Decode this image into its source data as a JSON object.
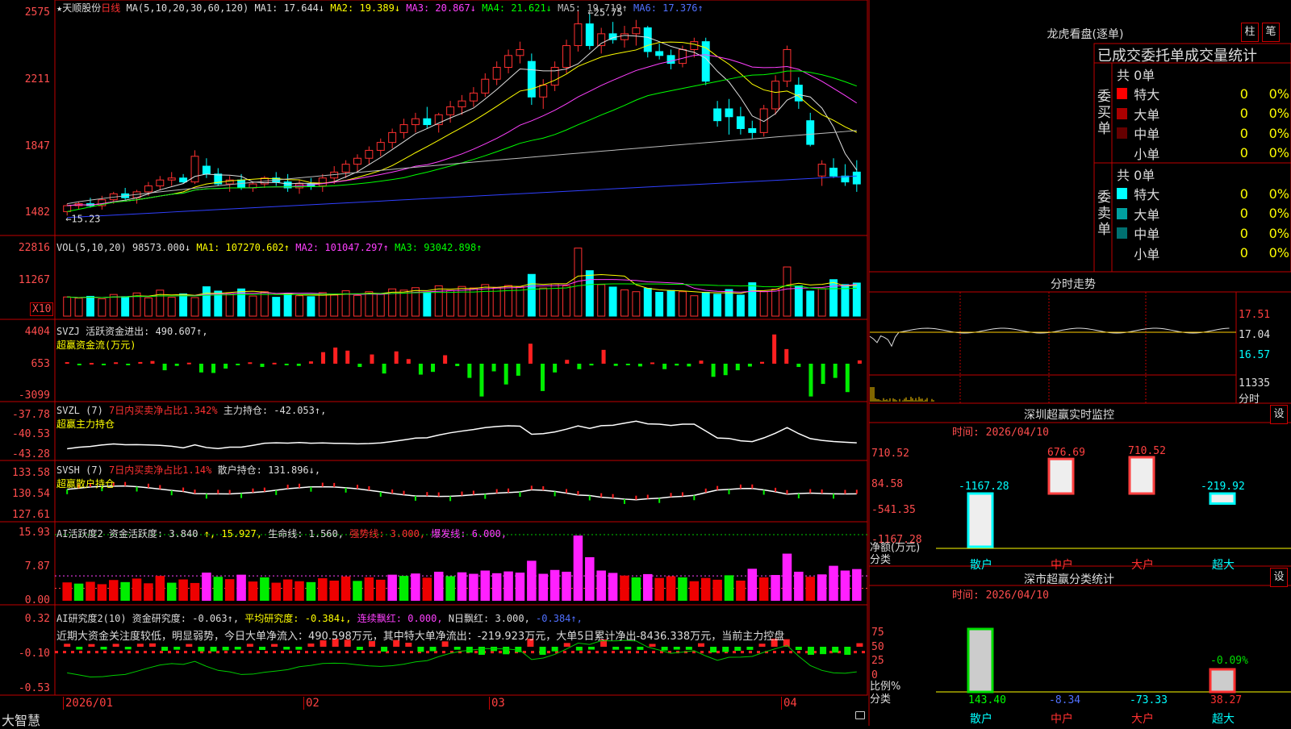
{
  "stock": {
    "name": "★天顺股份",
    "period": "日线",
    "ma_header": {
      "label": "MA(5,10,20,30,60,120)",
      "items": [
        {
          "text": "MA1: 17.644↓",
          "color": "#dddddd"
        },
        {
          "text": "MA2: 19.389↓",
          "color": "#ffff00"
        },
        {
          "text": "MA3: 20.867↓",
          "color": "#ff40ff"
        },
        {
          "text": "MA4: 21.621↓",
          "color": "#00ff00"
        },
        {
          "text": "MA5: 19.719↑",
          "color": "#bbbbbb"
        },
        {
          "text": "MA6: 17.376↑",
          "color": "#5070ff"
        }
      ]
    },
    "high_marker": "25.75",
    "low_marker": "15.23"
  },
  "main_axis": [
    "2575",
    "2211",
    "1847",
    "1482"
  ],
  "vol": {
    "header": {
      "label": "VOL(5,10,20)",
      "value": "98573.000↓",
      "items": [
        {
          "text": "MA1: 107270.602↑",
          "color": "#ffff00"
        },
        {
          "text": "MA2: 101047.297↑",
          "color": "#ff40ff"
        },
        {
          "text": "MA3: 93042.898↑",
          "color": "#00ff00"
        }
      ]
    },
    "axis": [
      "22816",
      "11267"
    ],
    "unit": "X10"
  },
  "svzj": {
    "line1": "SVZJ  活跃资金进出: 490.607↑,",
    "line2": "超赢资金流(万元)",
    "axis": [
      "4404",
      "653",
      "-3099"
    ]
  },
  "svzl": {
    "line1a": "SVZL (7)",
    "line1b": "7日内买卖净占比1.342%",
    "line1c": "主力持仓: -42.053↑,",
    "line2": "超赢主力持仓",
    "axis": [
      "-37.78",
      "-40.53",
      "-43.28"
    ]
  },
  "svsh": {
    "line1a": "SVSH (7)",
    "line1b": "7日内买卖净占比1.14%",
    "line1c": "散户持仓: 131.896↓,",
    "line2": "超赢散户持仓",
    "axis": [
      "133.58",
      "130.54",
      "127.61"
    ]
  },
  "ai1": {
    "items": [
      {
        "text": "AI活跃度2 资金活跃度: 3.840",
        "color": "#dddddd"
      },
      {
        "text": "↑, 15.927,",
        "color": "#ffff00"
      },
      {
        "text": " 生命线: 1.560,",
        "color": "#dddddd"
      },
      {
        "text": " 强势线: 3.000,",
        "color": "#ff3030"
      },
      {
        "text": " 爆发线: 6.000,",
        "color": "#ff40ff"
      }
    ],
    "axis": [
      "15.93",
      "7.87",
      "0.00"
    ]
  },
  "ai2": {
    "items": [
      {
        "text": "AI研究度2(10) 资金研究度: -0.063↑,",
        "color": "#dddddd"
      },
      {
        "text": " 平均研究度: -0.384↓,",
        "color": "#ffff00"
      },
      {
        "text": " 连续飘红: 0.000,",
        "color": "#ff40ff"
      },
      {
        "text": " N日飘红: 3.000,",
        "color": "#dddddd"
      },
      {
        "text": " -0.384↑,",
        "color": "#5070ff"
      }
    ],
    "comment": "近期大资金关注度较低，明显弱势，今日大单净流入：490.598万元，其中特大单净流出：-219.923万元，大单5日累计净出-8436.338万元，当前主力控盘",
    "axis": [
      "0.32",
      "-0.10",
      "-0.53"
    ]
  },
  "bottom": {
    "logo": "大智慧",
    "dates": [
      {
        "text": "2026/01",
        "x": 78
      },
      {
        "text": "02",
        "x": 376
      },
      {
        "text": "03",
        "x": 606
      },
      {
        "text": "04",
        "x": 968
      }
    ]
  },
  "longhu": {
    "title": "龙虎看盘(逐单)",
    "tab_a": "柱",
    "tab_b": "笔",
    "header": "已成交委托单成交量统计",
    "buy_label": "委买单",
    "sell_label": "委卖单",
    "buy_total": "共 0单",
    "sell_total": "共 0单",
    "buy_rows": [
      {
        "label": "特大",
        "color": "#ff0000",
        "count": "0",
        "pct": "0%"
      },
      {
        "label": "大单",
        "color": "#aa0000",
        "count": "0",
        "pct": "0%"
      },
      {
        "label": "中单",
        "color": "#660000",
        "count": "0",
        "pct": "0%"
      },
      {
        "label": "小单",
        "color": "#000000",
        "count": "0",
        "pct": "0%"
      }
    ],
    "sell_rows": [
      {
        "label": "特大",
        "color": "#00ffff",
        "count": "0",
        "pct": "0%"
      },
      {
        "label": "大单",
        "color": "#00a0a0",
        "count": "0",
        "pct": "0%"
      },
      {
        "label": "中单",
        "color": "#007070",
        "count": "0",
        "pct": "0%"
      },
      {
        "label": "小单",
        "color": "#000000",
        "count": "0",
        "pct": "0%"
      }
    ]
  },
  "fenshi": {
    "title": "分时走势",
    "axis": [
      "17.51",
      "17.04",
      "16.57",
      "11335"
    ],
    "unit": "分时"
  },
  "monitor": {
    "title": "深圳超赢实时监控",
    "set": "设",
    "time": "时间: 2026/04/10",
    "axis": [
      "710.52",
      "84.58",
      "-541.35",
      "-1167.28"
    ],
    "ylabel": "净额(万元)",
    "xlabel": "分类",
    "categories": [
      "散户",
      "中户",
      "大户",
      "超大"
    ],
    "values": [
      "-1167.28",
      "676.69",
      "710.52",
      "-219.92"
    ]
  },
  "classify": {
    "title": "深市超赢分类统计",
    "set": "设",
    "time": "时间: 2026/04/10",
    "axis": [
      "75",
      "50",
      "25",
      "0"
    ],
    "ylabel": "比例%",
    "xlabel": "分类",
    "categories": [
      "散户",
      "中户",
      "大户",
      "超大"
    ],
    "values": [
      "143.40",
      "-8.34",
      "-73.33",
      "38.27"
    ],
    "extra_label": "-0.09%"
  },
  "chart_data": [
    {
      "type": "candlestick",
      "title": "天顺股份 日线",
      "ylim": [
        14.8,
        25.9
      ],
      "ticks": [
        "25.75",
        "22.11",
        "18.47",
        "14.82"
      ],
      "annotations": {
        "high": 25.75,
        "low": 15.23
      },
      "ma": {
        "MA1": 17.644,
        "MA2": 19.389,
        "MA3": 20.867,
        "MA4": 21.621,
        "MA5": 19.719,
        "MA6": 17.376
      },
      "ohlc": [
        [
          15.6,
          16.0,
          15.4,
          15.9
        ],
        [
          15.9,
          16.1,
          15.7,
          16.0
        ],
        [
          16.0,
          16.3,
          15.8,
          15.9
        ],
        [
          15.9,
          16.4,
          15.7,
          16.2
        ],
        [
          16.2,
          16.6,
          16.0,
          16.5
        ],
        [
          16.5,
          16.8,
          16.2,
          16.3
        ],
        [
          16.3,
          16.7,
          16.0,
          16.6
        ],
        [
          16.6,
          17.1,
          16.4,
          16.9
        ],
        [
          16.9,
          17.4,
          16.7,
          17.2
        ],
        [
          17.2,
          17.6,
          16.9,
          17.3
        ],
        [
          17.3,
          17.5,
          17.0,
          17.1
        ],
        [
          17.1,
          18.7,
          17.0,
          18.4
        ],
        [
          17.9,
          18.3,
          17.3,
          17.5
        ],
        [
          17.5,
          17.8,
          16.9,
          17.0
        ],
        [
          17.0,
          17.4,
          16.6,
          17.2
        ],
        [
          17.2,
          17.5,
          16.7,
          16.8
        ],
        [
          16.8,
          17.1,
          16.6,
          17.0
        ],
        [
          17.0,
          17.4,
          16.8,
          17.3
        ],
        [
          17.3,
          17.6,
          16.9,
          17.1
        ],
        [
          17.1,
          17.5,
          16.6,
          16.8
        ],
        [
          16.8,
          17.2,
          16.5,
          17.0
        ],
        [
          17.0,
          17.3,
          16.7,
          16.9
        ],
        [
          16.9,
          17.5,
          16.6,
          17.3
        ],
        [
          17.3,
          17.9,
          17.0,
          17.6
        ],
        [
          17.6,
          18.2,
          17.3,
          18.0
        ],
        [
          18.0,
          18.5,
          17.6,
          18.3
        ],
        [
          18.3,
          18.9,
          18.0,
          18.7
        ],
        [
          18.7,
          19.3,
          18.4,
          19.1
        ],
        [
          19.1,
          19.8,
          18.8,
          19.6
        ],
        [
          19.6,
          20.3,
          19.3,
          20.0
        ],
        [
          20.0,
          20.6,
          19.6,
          20.3
        ],
        [
          20.3,
          20.9,
          19.8,
          20.0
        ],
        [
          20.0,
          20.6,
          19.6,
          20.5
        ],
        [
          20.5,
          21.2,
          20.1,
          20.9
        ],
        [
          20.9,
          21.5,
          20.5,
          21.2
        ],
        [
          21.2,
          21.9,
          20.9,
          21.6
        ],
        [
          21.6,
          22.6,
          21.4,
          22.3
        ],
        [
          22.3,
          23.2,
          22.0,
          22.9
        ],
        [
          22.9,
          23.8,
          22.6,
          23.5
        ],
        [
          23.5,
          24.2,
          23.1,
          23.8
        ],
        [
          23.2,
          23.6,
          21.0,
          21.4
        ],
        [
          21.4,
          22.3,
          20.8,
          22.0
        ],
        [
          22.0,
          23.2,
          21.7,
          22.9
        ],
        [
          22.9,
          24.3,
          22.6,
          24.0
        ],
        [
          24.0,
          25.75,
          23.7,
          25.1
        ],
        [
          25.1,
          25.6,
          23.8,
          24.0
        ],
        [
          24.0,
          24.9,
          23.6,
          24.6
        ],
        [
          24.6,
          25.2,
          24.1,
          24.3
        ],
        [
          24.3,
          25.0,
          23.9,
          24.6
        ],
        [
          24.6,
          25.3,
          24.0,
          24.9
        ],
        [
          24.9,
          25.0,
          23.4,
          23.7
        ],
        [
          23.7,
          24.1,
          23.3,
          23.5
        ],
        [
          23.5,
          23.8,
          22.8,
          23.1
        ],
        [
          23.1,
          24.0,
          22.9,
          23.8
        ],
        [
          23.8,
          24.4,
          23.4,
          24.2
        ],
        [
          24.2,
          24.4,
          22.0,
          22.2
        ],
        [
          20.8,
          21.2,
          19.9,
          20.2
        ],
        [
          20.8,
          21.3,
          19.5,
          20.4
        ],
        [
          20.4,
          20.9,
          19.5,
          19.8
        ],
        [
          19.8,
          20.2,
          19.3,
          19.6
        ],
        [
          19.6,
          21.0,
          19.4,
          20.8
        ],
        [
          20.8,
          22.5,
          20.5,
          22.2
        ],
        [
          22.2,
          24.0,
          21.9,
          23.8
        ],
        [
          22.0,
          22.4,
          20.8,
          21.2
        ],
        [
          20.2,
          20.6,
          18.9,
          19.0
        ],
        [
          17.4,
          18.2,
          16.9,
          18.0
        ],
        [
          17.8,
          18.3,
          17.3,
          17.4
        ],
        [
          17.4,
          18.0,
          16.9,
          17.1
        ],
        [
          17.6,
          18.2,
          16.6,
          17.0
        ]
      ]
    },
    {
      "type": "bar",
      "title": "VOL(5,10,20)",
      "ylim": [
        0,
        24000
      ],
      "ticks": [
        "22816",
        "11267"
      ],
      "unit": "X10",
      "last": 98573,
      "ma": {
        "MA1": 107270.602,
        "MA2": 101047.297,
        "MA3": 93042.898
      },
      "values": [
        6200,
        5800,
        6400,
        5600,
        7000,
        6300,
        7500,
        5900,
        8400,
        6100,
        7200,
        6000,
        9500,
        8100,
        7300,
        8800,
        6500,
        7900,
        6100,
        7200,
        6600,
        6300,
        7600,
        6800,
        8200,
        6700,
        7900,
        7100,
        8800,
        8400,
        9200,
        7800,
        9800,
        8300,
        9600,
        9100,
        10200,
        9300,
        9900,
        9500,
        13500,
        9100,
        10400,
        9800,
        22000,
        14700,
        10200,
        9400,
        8500,
        7900,
        9000,
        7700,
        8300,
        7900,
        6600,
        7700,
        7100,
        8600,
        6800,
        10800,
        7900,
        8700,
        15900,
        9800,
        8100,
        8900,
        11800,
        10200,
        10700
      ]
    },
    {
      "type": "bar",
      "title": "SVZJ 活跃资金进出",
      "ylim": [
        -3099,
        4404
      ],
      "ticks": [
        "4404",
        "653",
        "-3099"
      ],
      "last": 490.607,
      "values": [
        200,
        -150,
        100,
        -120,
        180,
        -90,
        220,
        350,
        -600,
        -200,
        130,
        -800,
        -850,
        -450,
        -150,
        180,
        -300,
        120,
        -150,
        -200,
        300,
        1500,
        2100,
        1700,
        -300,
        1200,
        -900,
        1600,
        600,
        -1000,
        -750,
        1100,
        -220,
        -1300,
        -3000,
        -700,
        -1900,
        -1100,
        2600,
        -2500,
        -800,
        500,
        -500,
        -160,
        1800,
        -200,
        -110,
        -250,
        160,
        -500,
        -170,
        -250,
        400,
        -1200,
        -1050,
        -600,
        -260,
        240,
        3800,
        1900,
        -300,
        -3000,
        -1850,
        -1300,
        -2600,
        430
      ]
    },
    {
      "type": "line",
      "title": "SVZL 主力持仓",
      "ylim": [
        -43.28,
        -37.78
      ],
      "ticks": [
        "-37.78",
        "-40.53",
        "-43.28"
      ],
      "last": -42.053
    },
    {
      "type": "line",
      "title": "SVSH 散户持仓",
      "ylim": [
        127.61,
        133.58
      ],
      "ticks": [
        "133.58",
        "130.54",
        "127.61"
      ],
      "last": 131.896
    },
    {
      "type": "bar",
      "title": "AI活跃度2",
      "ylim": [
        0,
        15.93
      ],
      "ticks": [
        "15.93",
        "7.87",
        "0.00"
      ],
      "last": 3.84,
      "lines": {
        "生命线": 1.56,
        "强势线": 3.0,
        "爆发线": 6.0
      }
    },
    {
      "type": "bar",
      "title": "AI研究度2(10)",
      "ylim": [
        -0.53,
        0.32
      ],
      "ticks": [
        "0.32",
        "-0.10",
        "-0.53"
      ],
      "last": -0.063,
      "avg": -0.384
    },
    {
      "type": "bar",
      "title": "深圳超赢实时监控",
      "categories": [
        "散户",
        "中户",
        "大户",
        "超大"
      ],
      "values": [
        -1167.28,
        676.69,
        710.52,
        -219.92
      ],
      "ylim": [
        -1167.28,
        710.52
      ],
      "ylabel": "净额(万元)"
    },
    {
      "type": "bar",
      "title": "深市超赢分类统计",
      "categories": [
        "散户",
        "中户",
        "大户",
        "超大"
      ],
      "values": [
        143.4,
        -8.34,
        -73.33,
        38.27
      ],
      "ylim": [
        0,
        100
      ],
      "ylabel": "比例%"
    }
  ],
  "colors": {
    "up": "#ff3030",
    "down": "#00ffff",
    "grid": "#a00000",
    "bg": "#000000"
  }
}
